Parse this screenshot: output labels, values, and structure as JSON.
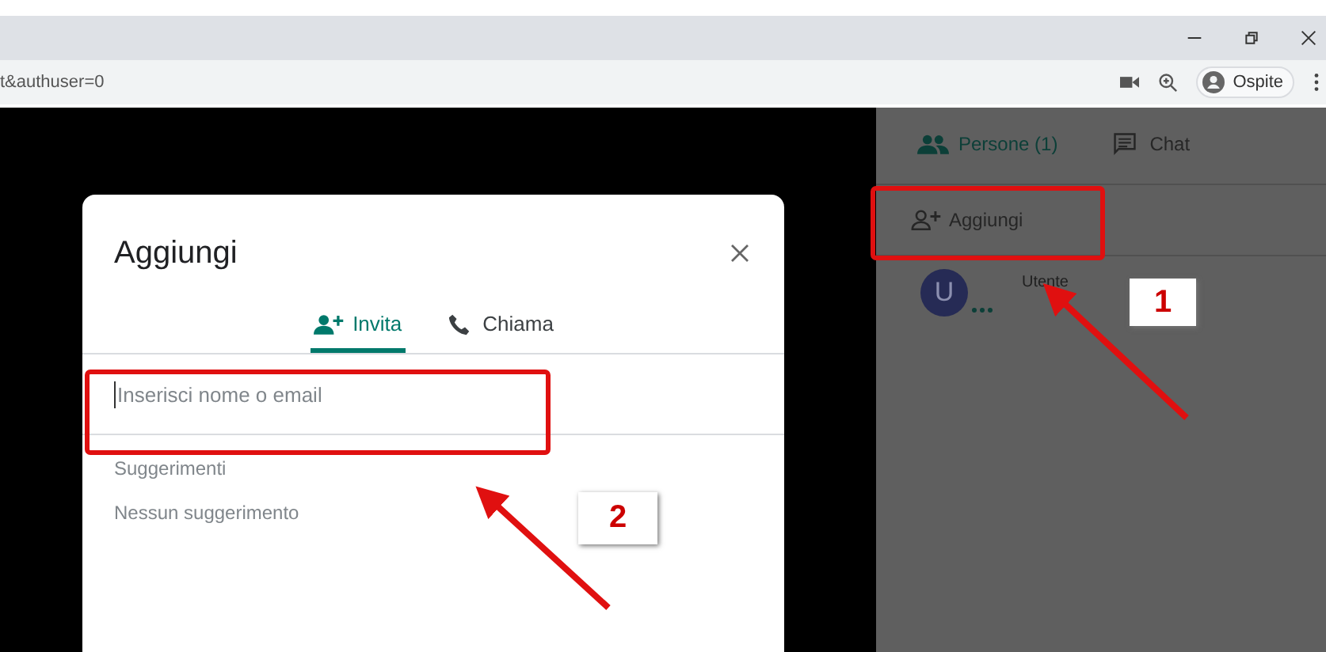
{
  "browser": {
    "address": "t&authuser=0",
    "profile": "Ospite"
  },
  "side_panel": {
    "tabs": [
      {
        "label": "Persone (1)",
        "kind": "people",
        "selected": true
      },
      {
        "label": "Chat",
        "kind": "chat",
        "selected": false
      }
    ],
    "add_button": "Aggiungi",
    "participants": [
      {
        "initial": "U",
        "name": "Utente"
      }
    ]
  },
  "dialog": {
    "title": "Aggiungi",
    "tabs": [
      {
        "label": "Invita",
        "kind": "invite",
        "selected": true
      },
      {
        "label": "Chiama",
        "kind": "call",
        "selected": false
      }
    ],
    "input": {
      "placeholder": "Inserisci nome o email"
    },
    "suggestions_heading": "Suggerimenti",
    "suggestions_empty": "Nessun suggerimento"
  },
  "annotations": [
    {
      "number": "1"
    },
    {
      "number": "2"
    }
  ]
}
